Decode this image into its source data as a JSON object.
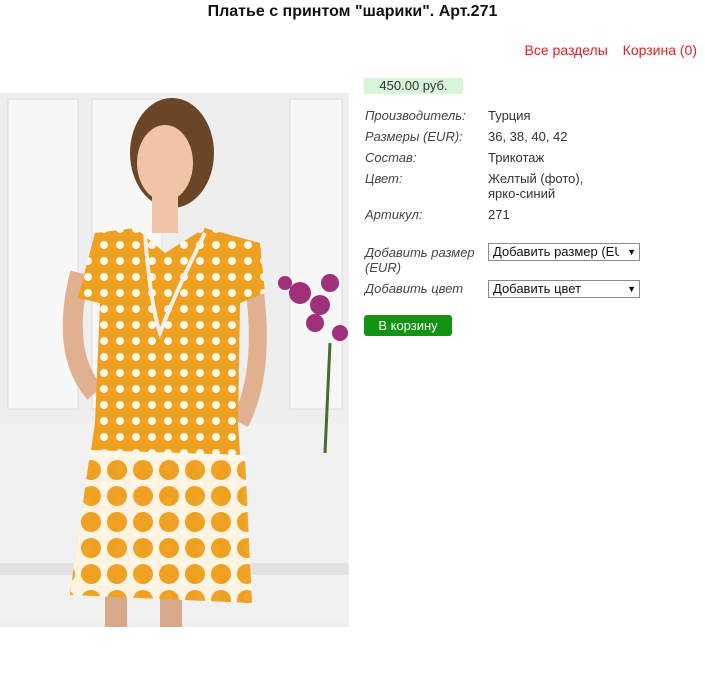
{
  "page": {
    "title": "Платье с принтом \"шарики\". Арт.271"
  },
  "nav": {
    "sections_link": "Все разделы",
    "cart_link": "Корзина (0)"
  },
  "product": {
    "price": "450.00 руб.",
    "photo_icon": "dress-photo",
    "properties": [
      {
        "label": "Производитель:",
        "value": "Турция"
      },
      {
        "label": "Размеры (EUR):",
        "value": "36, 38, 40, 42"
      },
      {
        "label": "Состав:",
        "value": "Трикотаж"
      },
      {
        "label": "Цвет:",
        "value": "Желтый (фото),\nярко-синий"
      },
      {
        "label": "Артикул:",
        "value": "271"
      }
    ]
  },
  "options": {
    "size_label": "Добавить размер (EUR)",
    "size_selected": "Добавить размер (EUR)",
    "color_label": "Добавить цвет",
    "color_selected": "Добавить цвет"
  },
  "actions": {
    "add_to_cart": "В корзину"
  },
  "colors": {
    "accent_link": "#dd2222",
    "button": "#119411",
    "price_bg": "#d7f5d7",
    "dress": "#f0a020"
  }
}
